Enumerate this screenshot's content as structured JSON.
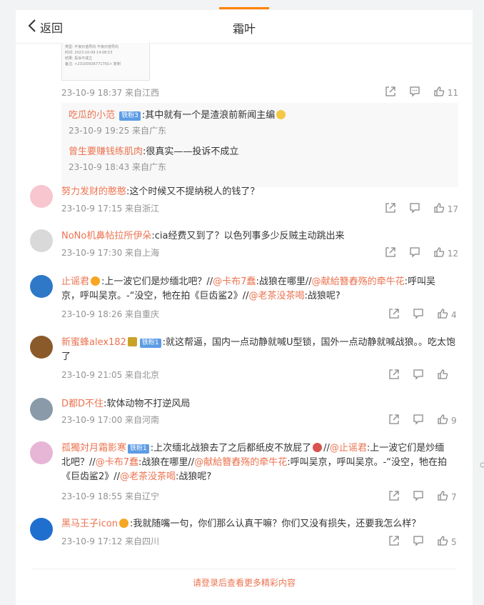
{
  "header": {
    "back_label": "返回",
    "title": "霜叶"
  },
  "thumb": {
    "lines": [
      "类型:   不良价值导向 不良价值导向",
      "时间:   2023-10-09 14:08:53",
      "结果:   投诉不成立",
      "备注:   <23100936771791> 复制"
    ]
  },
  "top_comment": {
    "meta": "23-10-9 18:37 来自江西",
    "likes": "11"
  },
  "replies": [
    {
      "user": "吃瓜的小范",
      "badge": "铁粉3",
      "text": ":其中就有一个是渣浪前新闻主编",
      "meta": "23-10-9 19:25 来自广东"
    },
    {
      "user": "曾生要赚钱练肌肉",
      "text": ":很真实——投诉不成立",
      "meta": "23-10-9 18:43 来自广东"
    }
  ],
  "comments": [
    {
      "user": "努力发财的憨憨",
      "text": ":这个时候又不提纳税人的钱了？",
      "meta": "23-10-9 17:15 来自浙江",
      "likes": "17"
    },
    {
      "user": "NoNo机鼻帖拉所伊朵",
      "text": ":cia经费又到了？以色列事多少反贼主动跳出来",
      "meta": "23-10-9 17:30 来自上海",
      "likes": "12"
    },
    {
      "user": "止谣君",
      "line1_a": ":上一波它们是炒缅北吧？//",
      "m1": "@卡布7蠢",
      "line1_b": ":战狼在哪里//",
      "m2": "@献給簪舂殇的牵牛花",
      "line1_c": ":呼叫吴",
      "line2_a": "京，呼叫吴京。-“没空，牠在拍《巨齿鲨2》//",
      "m3": "@老茶没茶喝",
      "line2_b": ":战狼呢?",
      "meta": "23-10-9 18:26 来自重庆",
      "likes": "4"
    },
    {
      "user": "新蜜蜂alex182",
      "badge": "铁粉1",
      "line1": ":就这帮逼，国内一点动静就喊U型锁，国外一点动静就喊战狼。。吃太饱",
      "line2": "了",
      "meta": "23-10-9 21:05 来自北京",
      "likes": ""
    },
    {
      "user": "D都D不住",
      "text": ":软体动物不打逆风局",
      "meta": "23-10-9 17:00 来自河南",
      "likes": "9"
    },
    {
      "user": "孤獨対月霜影寒",
      "badge": "铁粉1",
      "line1_a": ":上次缅北战狼去了之后都纸皮不放屁了",
      "m0": "//",
      "m1": "@止谣君",
      "line1_b": ":上一波它们是炒缅",
      "line2_a": "北吧？//",
      "m2": "@卡布7蠢",
      "line2_b": ":战狼在哪里//",
      "m3": "@献給簪舂殇的牵牛花",
      "line2_c": ":呼叫吴京，呼叫吴京。-“没空，牠在拍",
      "line3_a": "《巨齿鲨2》//",
      "m4": "@老茶没茶喝",
      "line3_b": ":战狼呢?",
      "meta": "23-10-9 18:55 来自辽宁",
      "likes": "7"
    },
    {
      "user": "黑马王子icon",
      "text": ":我就随嘴一句，你们那么认真干嘛？你们又没有损失，还要我怎么样？",
      "meta": "23-10-9 17:12 来自四川",
      "likes": "5"
    }
  ],
  "footer": {
    "more_label": "请登录后查看更多精彩内容"
  },
  "colors": {
    "accent": "#ff8200",
    "username": "#eb7350",
    "meta": "#939393",
    "badge": "#5d9ce5"
  }
}
